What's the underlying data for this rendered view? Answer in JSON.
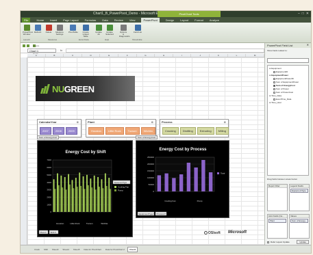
{
  "window": {
    "title": "Chart1_B_PowerPivot_Demo - Microsoft Excel",
    "context_tab_title": "PivotChart Tools"
  },
  "tabs": [
    "File",
    "Home",
    "Insert",
    "Page Layout",
    "Formulas",
    "Data",
    "Review",
    "View",
    "PowerPivot",
    "Design",
    "Layout",
    "Format",
    "Analyze"
  ],
  "active_tab": "PowerPivot",
  "ribbon": {
    "buttons": [
      "PowerPivot Window",
      "Refresh",
      "Delete",
      "Measure Settings",
      "PivotTable",
      "Create Linked Table",
      "Update All",
      "Update Selected",
      "Options & Diagnostics",
      "Field List"
    ],
    "groups": [
      "Launch",
      "Measures",
      "Excel Data",
      "Help",
      "Show/Hide"
    ]
  },
  "formula_bar": {
    "name_box": "Chart 1",
    "fx": "fx",
    "quick_label": "Freeze Cols Save Quick"
  },
  "columns": [
    "A",
    "B",
    "C",
    "D",
    "E",
    "F",
    "G",
    "H",
    "I",
    "J",
    "K",
    "L",
    "M"
  ],
  "banner": {
    "logo_prefix": "NU",
    "logo_suffix": "GREEN"
  },
  "slicers": {
    "calendar": {
      "title": "CalendarYear",
      "items": [
        "2007",
        "2008",
        "2009"
      ]
    },
    "plant": {
      "title": "Plant",
      "items": [
        "Houston",
        "Little Rock",
        "Tucson",
        "Wichita"
      ]
    },
    "process": {
      "title": "Process",
      "items": [
        "Cracking",
        "Distilling",
        "Extruding",
        "Milling"
      ]
    }
  },
  "chart_data": [
    {
      "type": "bar",
      "title": "Energy Cost by Shift",
      "tag": "Sum of EnergyCost",
      "legend_title": "EquipmentType",
      "legend": [
        "Cooling Fan",
        "Pump"
      ],
      "categories": [
        "Houston",
        "Little Rock",
        "Tucson",
        "Wichita"
      ],
      "ylim": [
        0,
        7000
      ],
      "yticks": [
        "7000",
        "6000",
        "5000",
        "4000",
        "3000",
        "2000",
        "1000",
        "0"
      ],
      "series": [
        {
          "name": "Cooling Fan",
          "values": [
            4400,
            5200,
            4900,
            4700,
            5100,
            4300,
            4600,
            5300,
            4800,
            5000,
            4500,
            4900,
            4700,
            4400,
            5200,
            4600
          ]
        },
        {
          "name": "Pump",
          "values": [
            3100,
            3600,
            3300,
            3000,
            3700,
            3200,
            3400,
            3500,
            3100,
            3600,
            3300,
            3000,
            3400,
            3200,
            3500,
            3100
          ]
        }
      ],
      "axis_buttons": [
        "Plant",
        "Shift"
      ]
    },
    {
      "type": "bar",
      "title": "Energy Cost by Process",
      "tag": "Sum of EnergyCost",
      "legend": [
        "Total"
      ],
      "categories": [
        "Cooling Fan",
        "Pump"
      ],
      "ylim": [
        0,
        250000
      ],
      "yticks": [
        "250000",
        "200000",
        "150000",
        "100000",
        "50000",
        "0"
      ],
      "series": [
        {
          "name": "Total",
          "values": [
            118000,
            132000,
            98000,
            125000,
            210000,
            175000,
            230000,
            140000
          ]
        }
      ],
      "axis_buttons": [
        "EquipmentType",
        "Process"
      ]
    }
  ],
  "bottom_logos": {
    "oss": "OSIsoft",
    "ms": "Microsoft"
  },
  "field_list": {
    "title": "PowerPivot Field List",
    "subtitle": "Show fields related to:",
    "tree": [
      {
        "level": 0,
        "text": "Equipment",
        "box": "none"
      },
      {
        "level": 1,
        "text": "EquipmentID",
        "box": "off"
      },
      {
        "level": 0,
        "text": "EquipmentPower",
        "box": "none",
        "bold": true
      },
      {
        "level": 1,
        "text": "EquipmentPowerID",
        "box": "off"
      },
      {
        "level": 1,
        "text": "Sum of EquipmentPower",
        "box": "off"
      },
      {
        "level": 1,
        "text": "Sum of EnergyCost",
        "box": "on",
        "bold": true
      },
      {
        "level": 1,
        "text": "Sum of Power",
        "box": "off"
      },
      {
        "level": 1,
        "text": "Sum of PowerCost",
        "box": "off"
      },
      {
        "level": 0,
        "text": "Time_Data",
        "box": "none"
      },
      {
        "level": 1,
        "text": "EventTime_Data",
        "box": "off"
      },
      {
        "level": 0,
        "text": "Time_Hour",
        "box": "none"
      }
    ],
    "drag_label": "Drag fields between areas below:",
    "areas": {
      "report_filter": {
        "title": "Report Filter",
        "chip": ""
      },
      "legend_fields": {
        "title": "Legend Fields",
        "chip": "EquipmentType"
      },
      "axis_fields": {
        "title": "Axis Fields (Ca...",
        "chip": "Plant"
      },
      "values": {
        "title": "Values",
        "chip": "Sum of Energy..."
      }
    },
    "defer_label": "Defer Layout Update",
    "update_button": "Update"
  },
  "sheet_tabs": [
    "Crack",
    "Shift",
    "Sheet3",
    "Sheet4",
    "Sheet5",
    "Data for PivotChart",
    "Data for PivotChart 2",
    "Chart1"
  ],
  "active_sheet": "Chart1"
}
